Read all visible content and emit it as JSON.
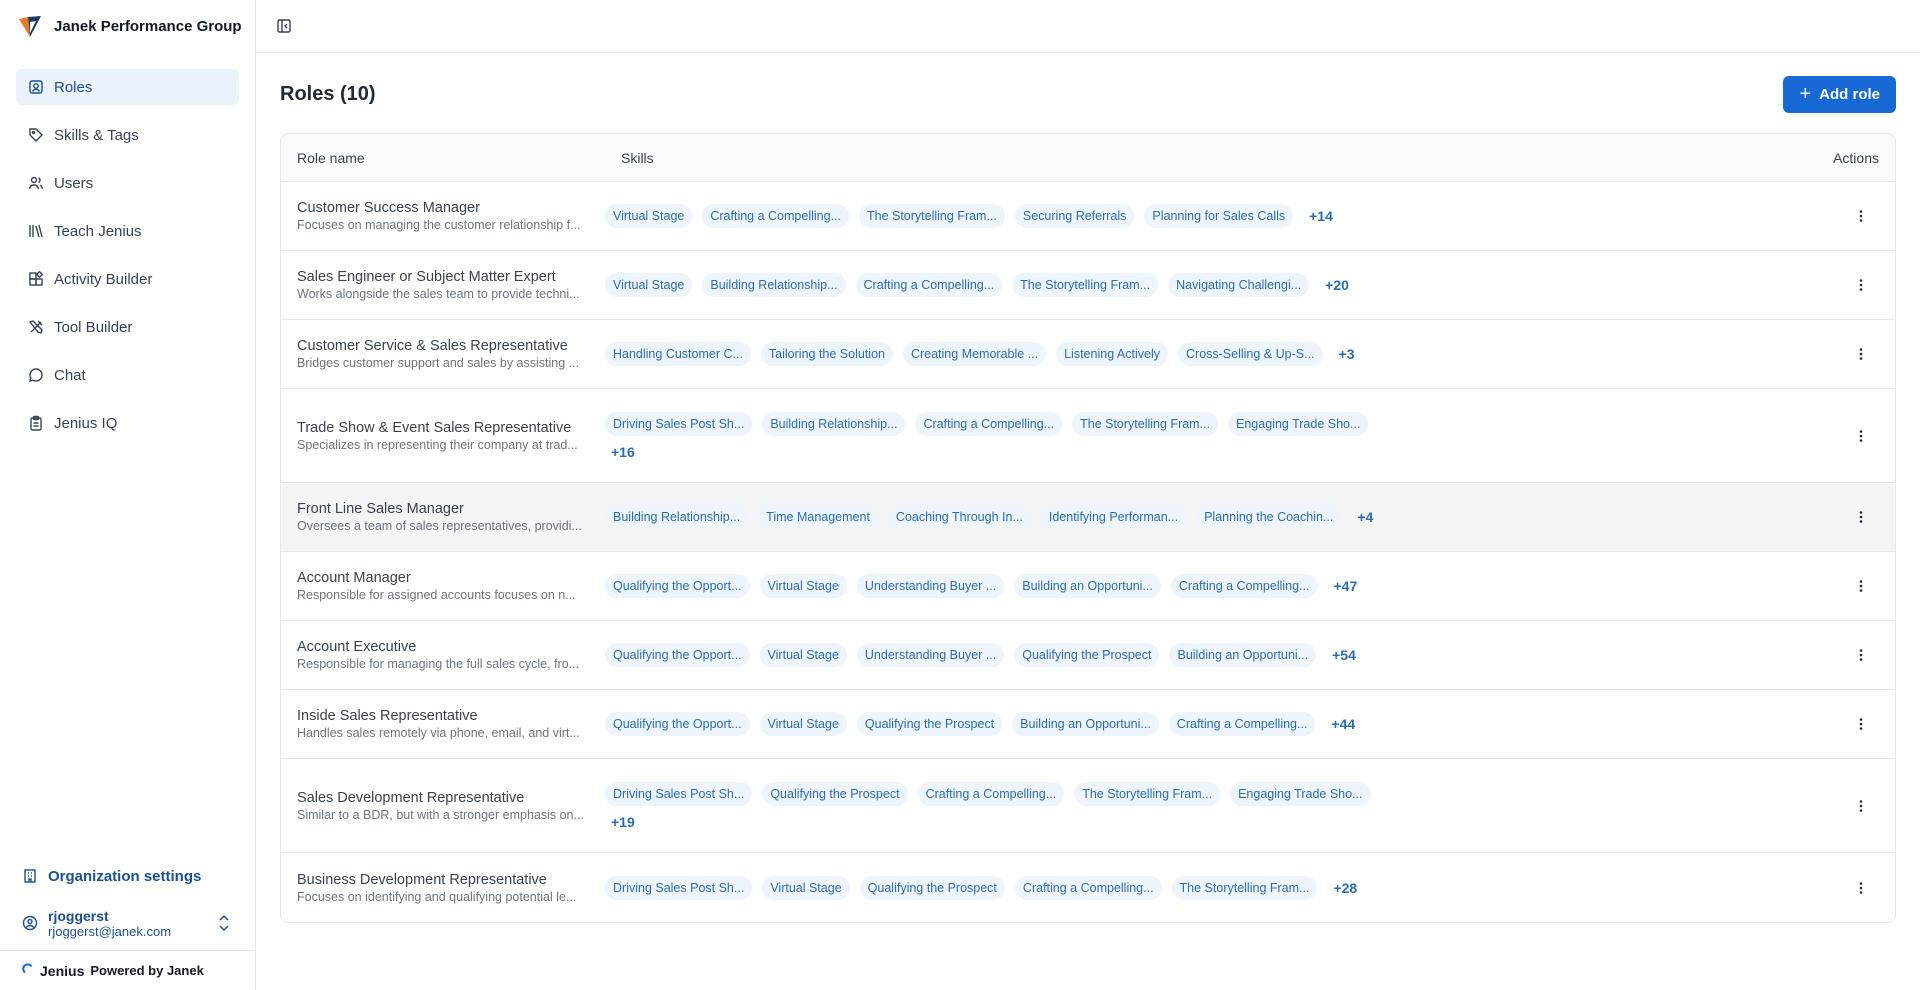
{
  "brand": {
    "name": "Janek Performance Group"
  },
  "sidebar": {
    "items": [
      {
        "label": "Roles",
        "icon": "roles-icon",
        "active": true
      },
      {
        "label": "Skills & Tags",
        "icon": "tag-icon"
      },
      {
        "label": "Users",
        "icon": "users-icon"
      },
      {
        "label": "Teach Jenius",
        "icon": "book-icon"
      },
      {
        "label": "Activity Builder",
        "icon": "blocks-icon"
      },
      {
        "label": "Tool Builder",
        "icon": "tools-icon"
      },
      {
        "label": "Chat",
        "icon": "chat-icon"
      },
      {
        "label": "Jenius IQ",
        "icon": "clipboard-icon"
      }
    ],
    "org_settings": "Organization settings",
    "user": {
      "name": "rjoggerst",
      "email": "rjoggerst@janek.com"
    },
    "footer": {
      "product": "Jenius",
      "powered": "Powered by Janek"
    }
  },
  "page": {
    "title": "Roles (10)",
    "add_label": "Add role"
  },
  "table": {
    "headers": {
      "role": "Role name",
      "skills": "Skills",
      "actions": "Actions"
    },
    "rows": [
      {
        "name": "Customer Success Manager",
        "desc": "Focuses on managing the customer relationship f...",
        "skills": [
          "Virtual Stage",
          "Crafting a Compelling...",
          "The Storytelling Fram...",
          "Securing Referrals",
          "Planning for Sales Calls"
        ],
        "more": "+14"
      },
      {
        "name": "Sales Engineer or Subject Matter Expert",
        "desc": "Works alongside the sales team to provide techni...",
        "skills": [
          "Virtual Stage",
          "Building Relationship...",
          "Crafting a Compelling...",
          "The Storytelling Fram...",
          "Navigating Challengi..."
        ],
        "more": "+20"
      },
      {
        "name": "Customer Service & Sales Representative",
        "desc": "Bridges customer support and sales by assisting ...",
        "skills": [
          "Handling Customer C...",
          "Tailoring the Solution",
          "Creating Memorable ...",
          "Listening Actively",
          "Cross-Selling & Up-S..."
        ],
        "more": "+3"
      },
      {
        "name": "Trade Show & Event Sales Representative",
        "desc": "Specializes in representing their company at trad...",
        "skills": [
          "Driving Sales Post Sh...",
          "Building Relationship...",
          "Crafting a Compelling...",
          "The Storytelling Fram...",
          "Engaging Trade Sho..."
        ],
        "more": "+16",
        "wrap": true
      },
      {
        "name": "Front Line Sales Manager",
        "desc": "Oversees a team of sales representatives, providi...",
        "skills": [
          "Building Relationship...",
          "Time Management",
          "Coaching Through In...",
          "Identifying Performan...",
          "Planning the Coachin..."
        ],
        "more": "+4",
        "hovered": true
      },
      {
        "name": "Account Manager",
        "desc": "Responsible for assigned accounts focuses on n...",
        "skills": [
          "Qualifying the Opport...",
          "Virtual Stage",
          "Understanding Buyer ...",
          "Building an Opportuni...",
          "Crafting a Compelling..."
        ],
        "more": "+47"
      },
      {
        "name": "Account Executive",
        "desc": "Responsible for managing the full sales cycle, fro...",
        "skills": [
          "Qualifying the Opport...",
          "Virtual Stage",
          "Understanding Buyer ...",
          "Qualifying the Prospect",
          "Building an Opportuni..."
        ],
        "more": "+54"
      },
      {
        "name": "Inside Sales Representative",
        "desc": "Handles sales remotely via phone, email, and virt...",
        "skills": [
          "Qualifying the Opport...",
          "Virtual Stage",
          "Qualifying the Prospect",
          "Building an Opportuni...",
          "Crafting a Compelling..."
        ],
        "more": "+44"
      },
      {
        "name": "Sales Development Representative",
        "desc": "Similar to a BDR, but with a stronger emphasis on...",
        "skills": [
          "Driving Sales Post Sh...",
          "Qualifying the Prospect",
          "Crafting a Compelling...",
          "The Storytelling Fram...",
          "Engaging Trade Sho..."
        ],
        "more": "+19",
        "wrap": true
      },
      {
        "name": "Business Development Representative",
        "desc": "Focuses on identifying and qualifying potential le...",
        "skills": [
          "Driving Sales Post Sh...",
          "Virtual Stage",
          "Qualifying the Prospect",
          "Crafting a Compelling...",
          "The Storytelling Fram..."
        ],
        "more": "+28"
      }
    ]
  },
  "colors": {
    "accent": "#1769d6",
    "active_bg": "#eaf2fb",
    "chip_bg": "#eef4fb",
    "chip_text": "#2b6cb0"
  }
}
